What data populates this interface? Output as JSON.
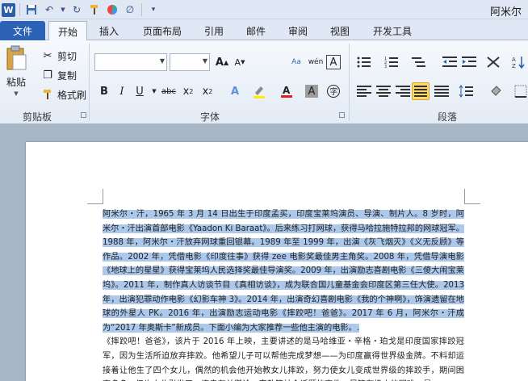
{
  "titlebar": {
    "app_icon": "W",
    "user": "阿米尔"
  },
  "tabs": [
    {
      "label": "文件"
    },
    {
      "label": "开始"
    },
    {
      "label": "插入"
    },
    {
      "label": "页面布局"
    },
    {
      "label": "引用"
    },
    {
      "label": "邮件"
    },
    {
      "label": "审阅"
    },
    {
      "label": "视图"
    },
    {
      "label": "开发工具"
    }
  ],
  "clipboard": {
    "paste_label": "粘贴",
    "cut_label": "剪切",
    "copy_label": "复制",
    "format_painter_label": "格式刷",
    "group_label": "剪贴板"
  },
  "font": {
    "font_name": "",
    "font_size": "",
    "group_label": "字体"
  },
  "paragraph": {
    "group_label": "段落"
  },
  "document": {
    "paragraph1": "阿米尔・汗，1965 年 3 月 14 日出生于印度孟买，印度宝莱坞演员、导演、制片人。8 岁时，阿米尔・汗出演首部电影《Yaadon Ki Baraat》。后来练习打网球，获得马哈拉施特拉邦的网球冠军。1988 年，阿米尔・汗放弃网球重回银幕。1989 年至 1999 年，出演《灰飞烟灭》《义无反顾》等作品。2002 年，凭借电影《印度往事》获得 zee 电影奖最佳男主角奖。2008 年，凭借导演电影《地球上的星星》获得宝莱坞人民选择奖最佳导演奖。2009 年，出演励志喜剧电影《三傻大闹宝莱坞》。2011 年，制作真人访谈节目《真相访谈》，成为联合国儿童基金会印度区第三任大使。2013 年，出演犯罪动作电影《幻影车神 3》。2014 年，出演奇幻喜剧电影《我的个神啊》，饰演遗留在地球的外星人 PK。2016 年，出演励志运动电影《摔跤吧！爸爸》。2017 年 6 月，阿米尔・汗成为“2017 年奥斯卡”新成员。下面小编为大家推荐一些他主演的电影。.",
    "paragraph2": "《摔跤吧！爸爸》，该片于 2016 年上映，主要讲述的是马哈维亚・辛格・珀戈是印度国家摔跤冠军，因为生活所迫放弃摔跤。他希望儿子可以帮他完成梦想——为印度赢得世界级金牌。不料却运接着让他生了四个女儿，偶然的机会他开始教女儿摔跤，努力使女儿变成世界级的摔跤手，期间困事多多，但也由此引发了一连串有关舆论、宗教等社会话题的事件，尽管有极大的困难，最"
  }
}
